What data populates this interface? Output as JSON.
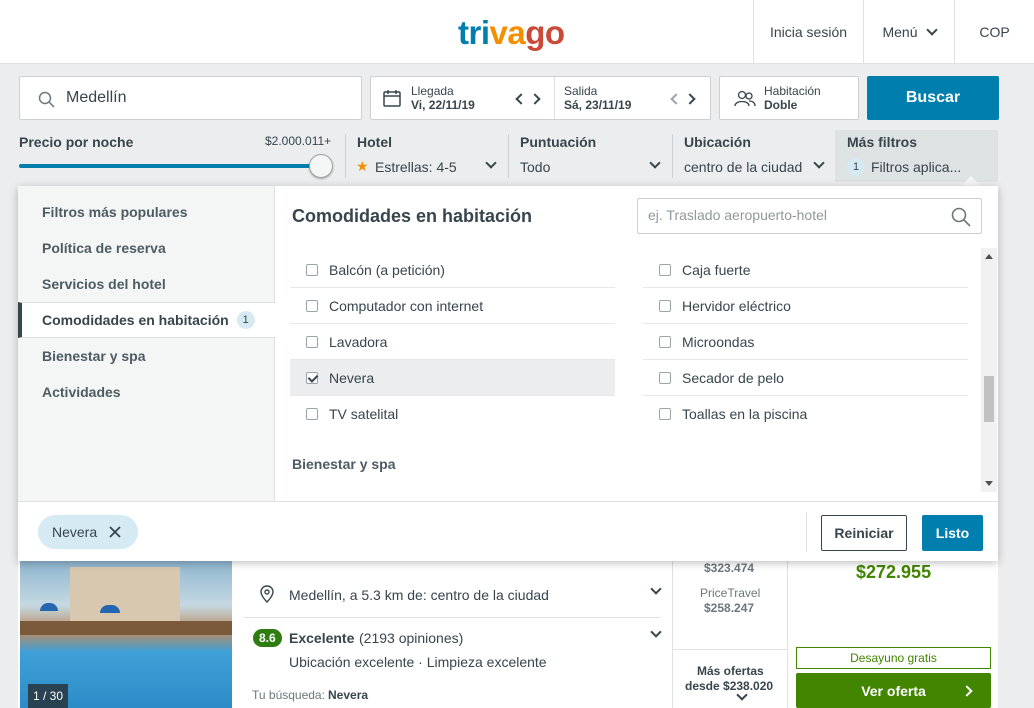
{
  "header": {
    "logo_parts": [
      "tri",
      "va",
      "go"
    ],
    "login": "Inicia sesión",
    "menu": "Menú",
    "currency": "COP"
  },
  "search": {
    "destination": "Medellín",
    "checkin_label": "Llegada",
    "checkin_value": "Vi, 22/11/19",
    "checkout_label": "Salida",
    "checkout_value": "Sá, 23/11/19",
    "room_label": "Habitación",
    "room_value": "Doble",
    "search_button": "Buscar"
  },
  "filters": {
    "price_label": "Precio por noche",
    "price_value": "$2.000.011+",
    "price_level": 1.0,
    "hotel_label": "Hotel",
    "hotel_value": "Estrellas: 4-5",
    "rating_label": "Puntuación",
    "rating_value": "Todo",
    "location_label": "Ubicación",
    "location_value": "centro de la ciudad",
    "more_label": "Más filtros",
    "more_count": "1",
    "more_value": "Filtros aplica..."
  },
  "panel": {
    "sidebar": [
      {
        "label": "Filtros más populares"
      },
      {
        "label": "Política de reserva"
      },
      {
        "label": "Servicios del hotel"
      },
      {
        "label": "Comodidades en habitación",
        "badge": "1"
      },
      {
        "label": "Bienestar y spa"
      },
      {
        "label": "Actividades"
      }
    ],
    "title": "Comodidades en habitación",
    "search_placeholder": "ej. Traslado aeropuerto-hotel",
    "left_options": [
      {
        "label": "Balcón (a petición)",
        "checked": false
      },
      {
        "label": "Computador con internet",
        "checked": false
      },
      {
        "label": "Lavadora",
        "checked": false
      },
      {
        "label": "Nevera",
        "checked": true
      },
      {
        "label": "TV satelital",
        "checked": false
      }
    ],
    "right_options": [
      {
        "label": "Caja fuerte",
        "checked": false
      },
      {
        "label": "Hervidor eléctrico",
        "checked": false
      },
      {
        "label": "Microondas",
        "checked": false
      },
      {
        "label": "Secador de pelo",
        "checked": false
      },
      {
        "label": "Toallas en la piscina",
        "checked": false
      }
    ],
    "next_group": "Bienestar y spa",
    "chip": "Nevera",
    "reset": "Reiniciar",
    "done": "Listo"
  },
  "hotel": {
    "photo_count": "1 / 30",
    "location": "Medellín, a 5.3 km de: centro de la ciudad",
    "score": "8.6",
    "score_label": "Excelente",
    "reviews": "(2193 opiniones)",
    "highlights": "Ubicación excelente · Limpieza excelente",
    "search_label": "Tu búsqueda:",
    "search_value": "Nevera",
    "price_top": "$323.474",
    "provider": "PriceTravel",
    "provider_price": "$258.247",
    "more_offers": "Más ofertas",
    "more_offers_from": "desde $238.020",
    "best_price": "$272.955",
    "breakfast": "Desayuno gratis",
    "deal_button": "Ver oferta"
  },
  "colors": {
    "primary": "#007faf",
    "deal_green": "#428500",
    "star": "#f48f00"
  }
}
